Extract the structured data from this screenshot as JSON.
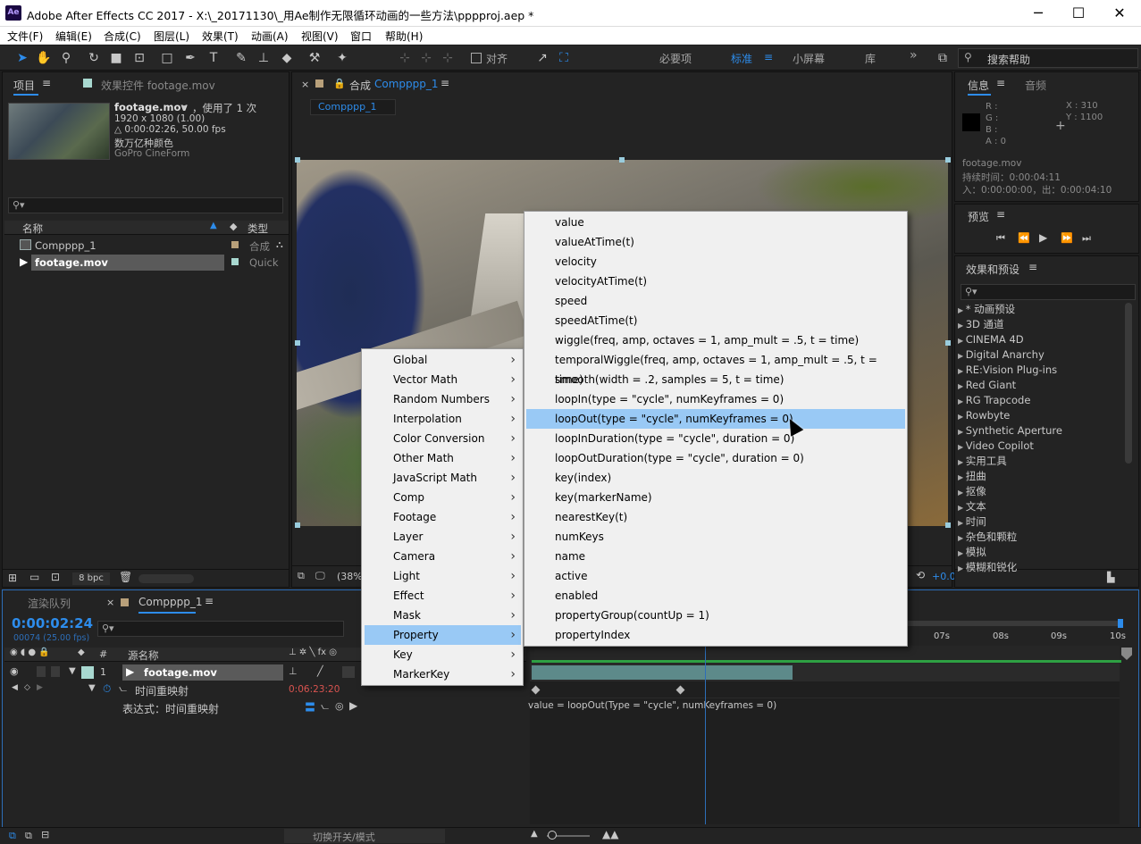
{
  "window": {
    "app_icon": "Ae",
    "title": "Adobe After Effects CC 2017 - X:\\_20171130\\_用Ae制作无限循环动画的一些方法\\pppproj.aep *",
    "minimize": "─",
    "maximize": "☐",
    "close": "✕"
  },
  "menubar": [
    "文件(F)",
    "编辑(E)",
    "合成(C)",
    "图层(L)",
    "效果(T)",
    "动画(A)",
    "视图(V)",
    "窗口",
    "帮助(H)"
  ],
  "toolbar": {
    "snap_label": "对齐",
    "workspaces": [
      "必要项",
      "标准",
      "小屏幕",
      "库"
    ],
    "active_workspace": "标准",
    "more": "»",
    "search_placeholder": "搜索帮助"
  },
  "project_panel": {
    "tab_project": "项目",
    "tab_effects": "效果控件 footage.mov",
    "footage_name": "footage.mov",
    "footage_used": "，使用了 1 次",
    "resolution": "1920 x 1080 (1.00)",
    "duration": "△ 0:00:02:26, 50.00 fps",
    "colors": "数万亿种颜色",
    "codec": "GoPro CineForm",
    "col_name": "名称",
    "col_type": "类型",
    "items": [
      {
        "name": "Compppp_1",
        "type": "合成"
      },
      {
        "name": "footage.mov",
        "type": "Quick"
      }
    ],
    "bpc": "8 bpc"
  },
  "comp_panel": {
    "tab_prefix": "合成",
    "comp_name": "Compppp_1",
    "breadcrumb": "Compppp_1",
    "zoom": "(38%",
    "exposure": "+0.0"
  },
  "info_panel": {
    "tab_info": "信息",
    "tab_audio": "音频",
    "r": "R :",
    "g": "G :",
    "b": "B :",
    "a": "A : 0",
    "x": "X : 310",
    "y": "Y : 1100",
    "file": "footage.mov",
    "duration": "持续时间：0:00:04:11",
    "inout": "入：0:00:00:00，出：0:00:04:10"
  },
  "preview_panel": {
    "title": "预览"
  },
  "effects_panel": {
    "title": "效果和预设",
    "items": [
      "* 动画预设",
      "3D 通道",
      "CINEMA 4D",
      "Digital Anarchy",
      "RE:Vision Plug-ins",
      "Red Giant",
      "RG Trapcode",
      "Rowbyte",
      "Synthetic Aperture",
      "Video Copilot",
      "实用工具",
      "扭曲",
      "抠像",
      "文本",
      "时间",
      "杂色和颗粒",
      "模拟",
      "模糊和锐化"
    ]
  },
  "timeline": {
    "tab_render": "渲染队列",
    "tab_comp": "Compppp_1",
    "timecode": "0:00:02:24",
    "frames": "00074 (25.00 fps)",
    "col_hash": "#",
    "col_source": "源名称",
    "layer_num": "1",
    "layer_name": "footage.mov",
    "prop_name": "时间重映射",
    "prop_value": "0:06:23:20",
    "expr_label": "表达式：时间重映射",
    "expr_text": "value = loopOut(Type = \"cycle\", numKeyframes = 0)",
    "ruler": [
      "07s",
      "08s",
      "09s",
      "10s"
    ],
    "switch_mode": "切换开关/模式"
  },
  "context_menu": {
    "categories": [
      "Global",
      "Vector Math",
      "Random Numbers",
      "Interpolation",
      "Color Conversion",
      "Other Math",
      "JavaScript Math",
      "Comp",
      "Footage",
      "Layer",
      "Camera",
      "Light",
      "Effect",
      "Mask",
      "Property",
      "Key",
      "MarkerKey"
    ],
    "active_category": "Property",
    "submenu_items": [
      "value",
      "valueAtTime(t)",
      "velocity",
      "velocityAtTime(t)",
      "speed",
      "speedAtTime(t)",
      "wiggle(freq, amp, octaves = 1, amp_mult = .5, t = time)",
      "temporalWiggle(freq, amp, octaves = 1, amp_mult = .5, t = time)",
      "smooth(width = .2, samples = 5, t = time)",
      "loopIn(type = \"cycle\", numKeyframes = 0)",
      "loopOut(type = \"cycle\", numKeyframes = 0)",
      "loopInDuration(type = \"cycle\", duration = 0)",
      "loopOutDuration(type = \"cycle\", duration = 0)",
      "key(index)",
      "key(markerName)",
      "nearestKey(t)",
      "numKeys",
      "name",
      "active",
      "enabled",
      "propertyGroup(countUp = 1)",
      "propertyIndex"
    ],
    "highlighted_item": "loopOut(type = \"cycle\", numKeyframes = 0)"
  },
  "colors": {
    "accent": "#2d8ceb",
    "menu_highlight": "#99c9f5",
    "bar_green": "#2ea043"
  }
}
